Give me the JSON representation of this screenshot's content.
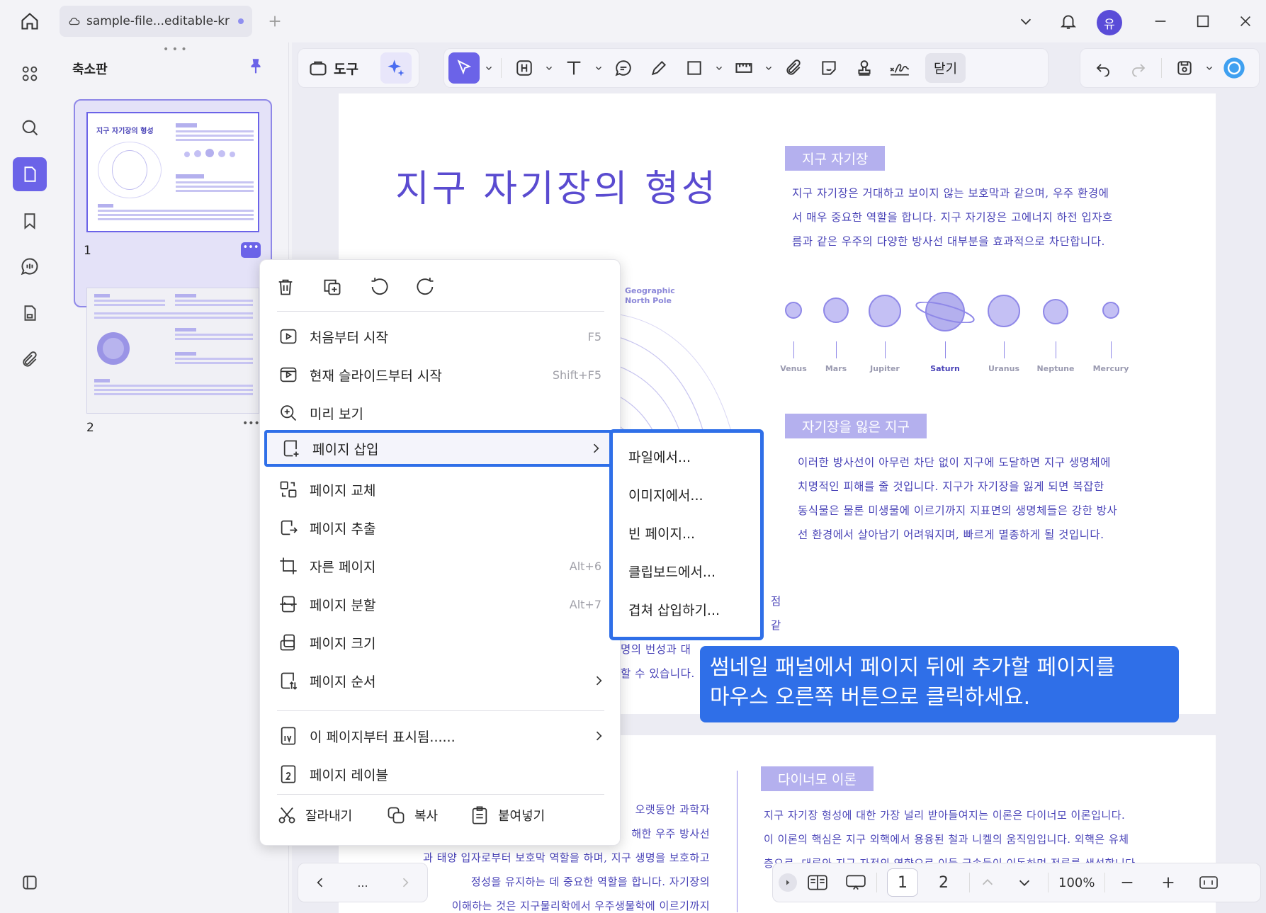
{
  "tab": {
    "title": "sample-file...editable-kr"
  },
  "user": {
    "avatar_initial": "유"
  },
  "panel": {
    "title": "축소판",
    "thumb1_num": "1",
    "thumb2_num": "2",
    "thumb1_title": "지구 자기장의 형성"
  },
  "toolbar": {
    "tools_label": "도구",
    "close_label": "닫기"
  },
  "doc": {
    "title": "지구 자기장의 형성",
    "sec1_heading": "지구 자기장",
    "sec1_body": [
      "지구 자기장은 거대하고 보이지 않는 보호막과 같으며, 우주 환경에",
      "서 매우 중요한 역할을 합니다. 지구 자기장은 고에너지 하전 입자흐",
      "름과 같은 우주의 다양한 방사선 대부분을 효과적으로 차단합니다."
    ],
    "planets": [
      "Venus",
      "Mars",
      "Jupiter",
      "Saturn",
      "Uranus",
      "Neptune",
      "Mercury"
    ],
    "diagram_label": [
      "Geographic",
      "North Pole"
    ],
    "sec2_heading": "자기장을 잃은 지구",
    "sec2_body": [
      "이러한 방사선이 아무런 차단 없이 지구에 도달하면 지구 생명체에",
      "치명적인 피해를 줄 것입니다. 지구가 자기장을 잃게 되면 복잡한",
      "동식물은 물론 미생물에 이르기까지 지표면의 생명체들은 강한 방사",
      "선 환경에서 살아남기 어려워지며, 빠르게 멸종하게 될 것입니다."
    ],
    "partial_right": [
      "점",
      "같"
    ],
    "partial_left": [
      "명의 번성과 대",
      "할 수 있습니다."
    ],
    "sec3_heading": "다이너모 이론",
    "sec3_body": [
      "지구 자기장 형성에 대한 가장 널리 받아들여지는 이론은 다이너모 이론입니다.",
      "이 이론의 핵심은 지구 외핵에서 용융된 철과 니켈의 움직임입니다. 외핵은 유체",
      "층으로, 대류와 지구 자전의 영향으로 이들 금속들이 이동하며 전류를 생성합니다"
    ],
    "page2_left": [
      "오랫동안 과학자",
      "해한 우주 방사선",
      "과 태양 입자로부터 보호막 역할을 하며, 지구 생명을 보호하고",
      "정성을 유지하는 데 중요한 역할을 합니다. 자기장의",
      "이해하는 것은 지구물리학에서 우주생물학에 이르기까지"
    ]
  },
  "context_menu": {
    "items": [
      {
        "label": "처음부터 시작",
        "shortcut": "F5"
      },
      {
        "label": "현재 슬라이드부터 시작",
        "shortcut": "Shift+F5"
      },
      {
        "label": "미리 보기",
        "shortcut": ""
      },
      {
        "label": "페이지 삽입",
        "shortcut": ""
      },
      {
        "label": "페이지 교체",
        "shortcut": ""
      },
      {
        "label": "페이지 추출",
        "shortcut": ""
      },
      {
        "label": "자른 페이지",
        "shortcut": "Alt+6"
      },
      {
        "label": "페이지 분할",
        "shortcut": "Alt+7"
      },
      {
        "label": "페이지 크기",
        "shortcut": ""
      },
      {
        "label": "페이지 순서",
        "shortcut": ""
      },
      {
        "label": "이 페이지부터 표시됨......",
        "shortcut": ""
      },
      {
        "label": "페이지 레이블",
        "shortcut": ""
      }
    ],
    "cut": "잘라내기",
    "copy": "복사",
    "paste": "붙여넣기"
  },
  "submenu": {
    "items": [
      "파일에서...",
      "이미지에서...",
      "빈 페이지...",
      "클립보드에서...",
      "겹쳐 삽입하기..."
    ]
  },
  "tooltip": {
    "line1": "썸네일 패널에서 페이지 뒤에 추가할 페이지를",
    "line2": "마우스 오른쪽 버튼으로 클릭하세요."
  },
  "nav": {
    "ellipsis": "...",
    "page1": "1",
    "page2": "2",
    "zoom": "100%"
  },
  "colors": {
    "accent": "#6b63e8",
    "highlight": "#2f6fe8",
    "doc_text": "#4a44b8"
  }
}
